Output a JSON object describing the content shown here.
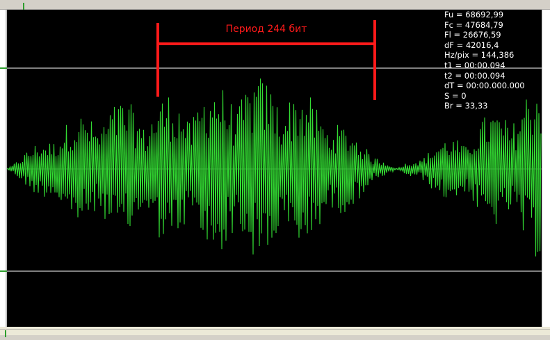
{
  "annotation": {
    "label": "Период 244 бит",
    "color": "#ff1a1a"
  },
  "readout": [
    {
      "text": "Fu = 68692,99"
    },
    {
      "text": "Fc = 47684,79"
    },
    {
      "text": "Fl = 26676,59"
    },
    {
      "text": "dF = 42016,4"
    },
    {
      "text": "Hz/pix = 144,386"
    },
    {
      "text": "t1 = 00:00.094"
    },
    {
      "text": "t2 = 00:00.094"
    },
    {
      "text": "dT = 00:00.000.000"
    },
    {
      "text": "S = 0"
    },
    {
      "text": "Br = 33,33"
    }
  ],
  "colors": {
    "background": "#000000",
    "waveform": "#33dd33",
    "guide": "#ffffff",
    "center": "#555555",
    "marker": "#ff1a1a"
  }
}
